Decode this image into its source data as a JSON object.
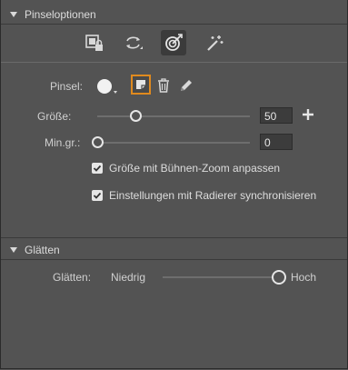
{
  "sections": {
    "brush_options": {
      "title": "Pinseloptionen"
    },
    "smoothing": {
      "title": "Glätten"
    }
  },
  "tool_icons": [
    "lock-fill-icon",
    "spray-rotate-icon",
    "pressure-target-icon",
    "magic-wand-icon"
  ],
  "brush": {
    "label": "Pinsel:",
    "size_label": "Größe:",
    "size_value": "50",
    "size_fraction": 0.25,
    "min_label": "Min.gr.:",
    "min_value": "0",
    "min_fraction": 0.0
  },
  "options": {
    "zoom_label": "Größe mit Bühnen-Zoom anpassen",
    "zoom_checked": true,
    "eraser_label": "Einstellungen mit Radierer synchronisieren",
    "eraser_checked": true
  },
  "smoothing": {
    "label": "Glätten:",
    "low_label": "Niedrig",
    "high_label": "Hoch",
    "fraction": 1.0
  },
  "colors": {
    "panel": "#535353",
    "accent": "#e08a1e"
  }
}
